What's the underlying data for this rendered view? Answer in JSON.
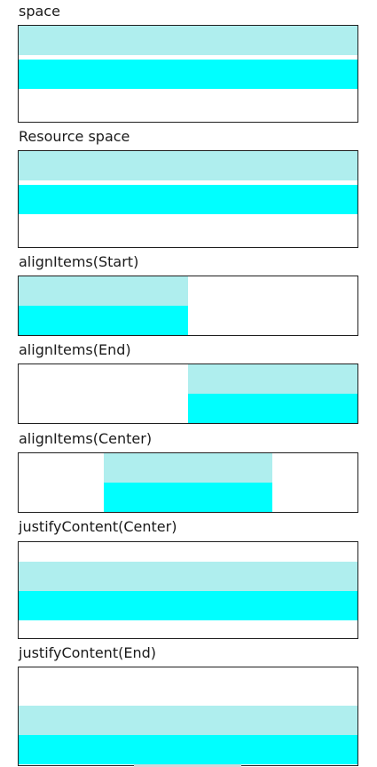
{
  "sections": [
    {
      "label": "space"
    },
    {
      "label": "Resource space"
    },
    {
      "label": "alignItems(Start)"
    },
    {
      "label": "alignItems(End)"
    },
    {
      "label": "alignItems(Center)"
    },
    {
      "label": "justifyContent(Center)"
    },
    {
      "label": "justifyContent(End)"
    }
  ],
  "colors": {
    "light_block": "#afeeee",
    "cyan_block": "#00ffff",
    "border": "#1f1f1f"
  }
}
